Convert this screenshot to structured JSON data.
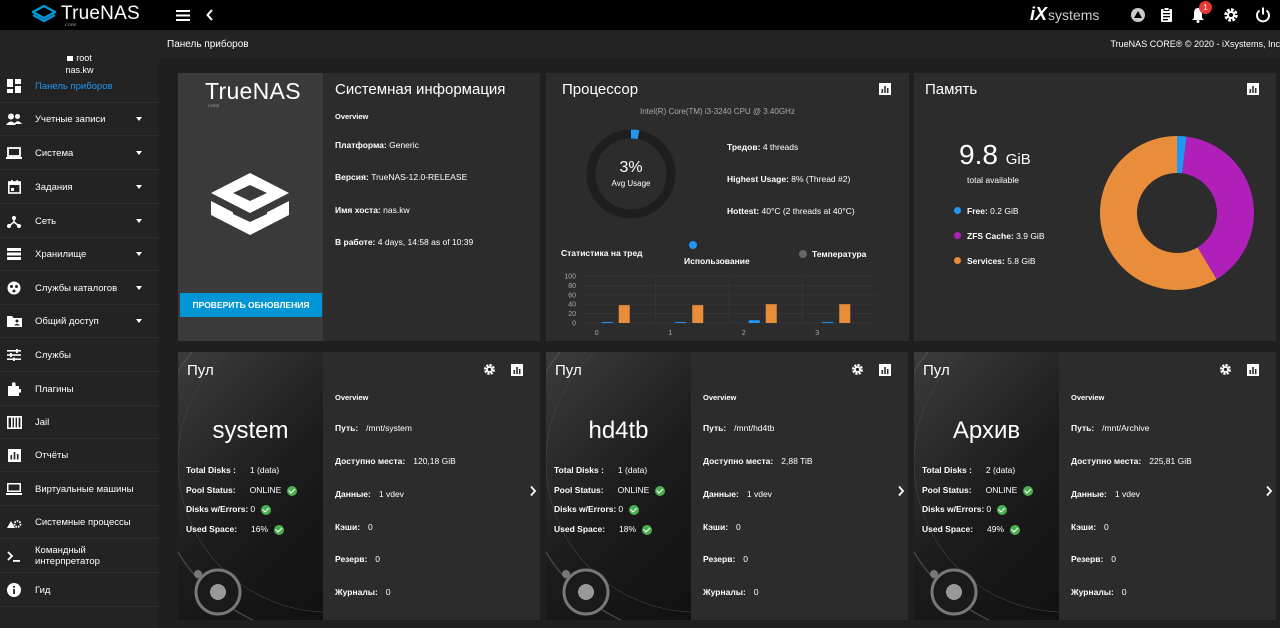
{
  "topbar": {
    "brand": "TrueNAS",
    "brand_sub": "CORE",
    "partner": "systems",
    "partner_prefix": "iX",
    "notif_count": "1"
  },
  "user": {
    "name": "root",
    "host": "nas.kw"
  },
  "nav": [
    {
      "label": "Панель приборов",
      "icon": "dashboard-icon",
      "active": true
    },
    {
      "label": "Учетные записи",
      "icon": "accounts-icon",
      "caret": true
    },
    {
      "label": "Система",
      "icon": "laptop-icon",
      "caret": true
    },
    {
      "label": "Задания",
      "icon": "calendar-icon",
      "caret": true
    },
    {
      "label": "Сеть",
      "icon": "network-icon",
      "caret": true
    },
    {
      "label": "Хранилище",
      "icon": "storage-icon",
      "caret": true
    },
    {
      "label": "Службы каталогов",
      "icon": "directory-icon",
      "caret": true
    },
    {
      "label": "Общий доступ",
      "icon": "folder-shared-icon",
      "caret": true
    },
    {
      "label": "Службы",
      "icon": "tune-icon"
    },
    {
      "label": "Плагины",
      "icon": "puzzle-icon"
    },
    {
      "label": "Jail",
      "icon": "jail-icon"
    },
    {
      "label": "Отчёты",
      "icon": "reports-icon"
    },
    {
      "label": "Виртуальные машины",
      "icon": "computer-icon"
    },
    {
      "label": "Системные процессы",
      "icon": "processes-icon"
    },
    {
      "label": "Командный интерпретатор",
      "icon": "shell-icon"
    },
    {
      "label": "Гид",
      "icon": "info-icon"
    }
  ],
  "page": {
    "title": "Панель приборов",
    "copyright": "TrueNAS CORE® © 2020 - iXsystems, Inc"
  },
  "sysinfo": {
    "logo_text": "TrueNAS",
    "logo_sub": "CORE",
    "title": "Системная информация",
    "overview": "Overview",
    "update_button": "ПРОВЕРИТЬ ОБНОВЛЕНИЯ",
    "rows": [
      {
        "k": "Платформа:",
        "v": "Generic"
      },
      {
        "k": "Версия:",
        "v": "TrueNAS-12.0-RELEASE"
      },
      {
        "k": "Имя хоста:",
        "v": "nas.kw"
      },
      {
        "k": "В работе:",
        "v": "4 days, 14:58 as of 10:39"
      }
    ]
  },
  "cpu": {
    "title": "Процессор",
    "model": "Intel(R) Core(TM) i3-3240 CPU @ 3.40GHz",
    "gauge_value": "3%",
    "gauge_label": "Avg Usage",
    "usage_fraction": 0.03,
    "threads_k": "Тредов:",
    "threads_v": "4 threads",
    "highest_k": "Highest Usage:",
    "highest_v": "8%  (Thread #2)",
    "hottest_k": "Hottest:",
    "hottest_v": "40°C  (2 threads at 40°C)",
    "legend_title": "Статистика на тред",
    "legend_usage": "Использование",
    "legend_temp": "Температура",
    "colors": {
      "usage": "#2196f3",
      "temp": "#e98d3a"
    }
  },
  "chart_data": {
    "type": "bar",
    "categories": [
      "0",
      "1",
      "2",
      "3"
    ],
    "series": [
      {
        "name": "Использование",
        "values": [
          2,
          2,
          6,
          2
        ]
      },
      {
        "name": "Температура",
        "values": [
          38,
          38,
          40,
          40
        ]
      }
    ],
    "y_ticks": [
      "100",
      "80",
      "60",
      "40",
      "20",
      "0"
    ],
    "ylim": [
      0,
      100
    ]
  },
  "memory": {
    "title": "Память",
    "total_value": "9.8",
    "total_unit": "GiB",
    "total_label": "total available",
    "legend": [
      {
        "label": "Free:",
        "value": "0.2 GiB",
        "color": "#2196f3",
        "gib": 0.2
      },
      {
        "label": "ZFS Cache:",
        "value": "3.9 GiB",
        "color": "#b020b8",
        "gib": 3.9
      },
      {
        "label": "Services:",
        "value": "5.8 GiB",
        "color": "#e98d3a",
        "gib": 5.8
      }
    ]
  },
  "pools": [
    {
      "heading": "Пул",
      "name": "system",
      "total_disks": "1 (data)",
      "status": "ONLINE",
      "errors": "0",
      "used": "16%",
      "overview": "Overview",
      "path": "/mnt/system",
      "avail": "120,18 GiB",
      "data": "1 vdev",
      "cache": "0",
      "spare": "0",
      "log": "0"
    },
    {
      "heading": "Пул",
      "name": "hd4tb",
      "total_disks": "1 (data)",
      "status": "ONLINE",
      "errors": "0",
      "used": "18%",
      "overview": "Overview",
      "path": "/mnt/hd4tb",
      "avail": "2,88 TiB",
      "data": "1 vdev",
      "cache": "0",
      "spare": "0",
      "log": "0"
    },
    {
      "heading": "Пул",
      "name": "Архив",
      "total_disks": "2 (data)",
      "status": "ONLINE",
      "errors": "0",
      "used": "49%",
      "overview": "Overview",
      "path": "/mnt/Archive",
      "avail": "225,81 GiB",
      "data": "1 vdev",
      "cache": "0",
      "spare": "0",
      "log": "0"
    }
  ],
  "pool_labels": {
    "total_disks": "Total Disks :",
    "status": "Pool Status:",
    "errors": "Disks w/Errors:",
    "used": "Used Space:",
    "path": "Путь:",
    "avail": "Доступно места:",
    "data": "Данные:",
    "cache": "Кэши:",
    "spare": "Резерв:",
    "log": "Журналы:"
  }
}
